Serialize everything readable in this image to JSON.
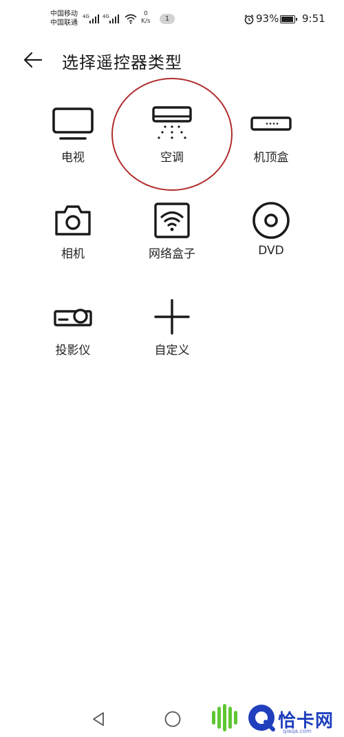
{
  "status_bar": {
    "carrier_1": "中国移动",
    "carrier_2": "中国联通",
    "net_tag_1": "4G",
    "net_tag_2": "4G",
    "speed_value": "0",
    "speed_unit": "K/s",
    "notification_count": "1",
    "battery": "93%",
    "battery_level": 0.93,
    "time": "9:51"
  },
  "header": {
    "title": "选择遥控器类型"
  },
  "device_types": [
    {
      "label": "电视",
      "icon": "tv-icon"
    },
    {
      "label": "空调",
      "icon": "air-conditioner-icon",
      "highlighted": true
    },
    {
      "label": "机顶盒",
      "icon": "set-top-box-icon"
    },
    {
      "label": "相机",
      "icon": "camera-icon"
    },
    {
      "label": "网络盒子",
      "icon": "network-box-icon"
    },
    {
      "label": "DVD",
      "icon": "dvd-icon"
    },
    {
      "label": "投影仪",
      "icon": "projector-icon"
    },
    {
      "label": "自定义",
      "icon": "plus-icon"
    }
  ],
  "watermark": {
    "brand": "恰卡网",
    "domain": "qiaqa.com",
    "brand_color": "#1f3fbd",
    "accent_color": "#5fc732"
  },
  "colors": {
    "highlight_circle": "#b02a2a",
    "icon_stroke": "#1a1a1a",
    "background": "#ffffff"
  }
}
